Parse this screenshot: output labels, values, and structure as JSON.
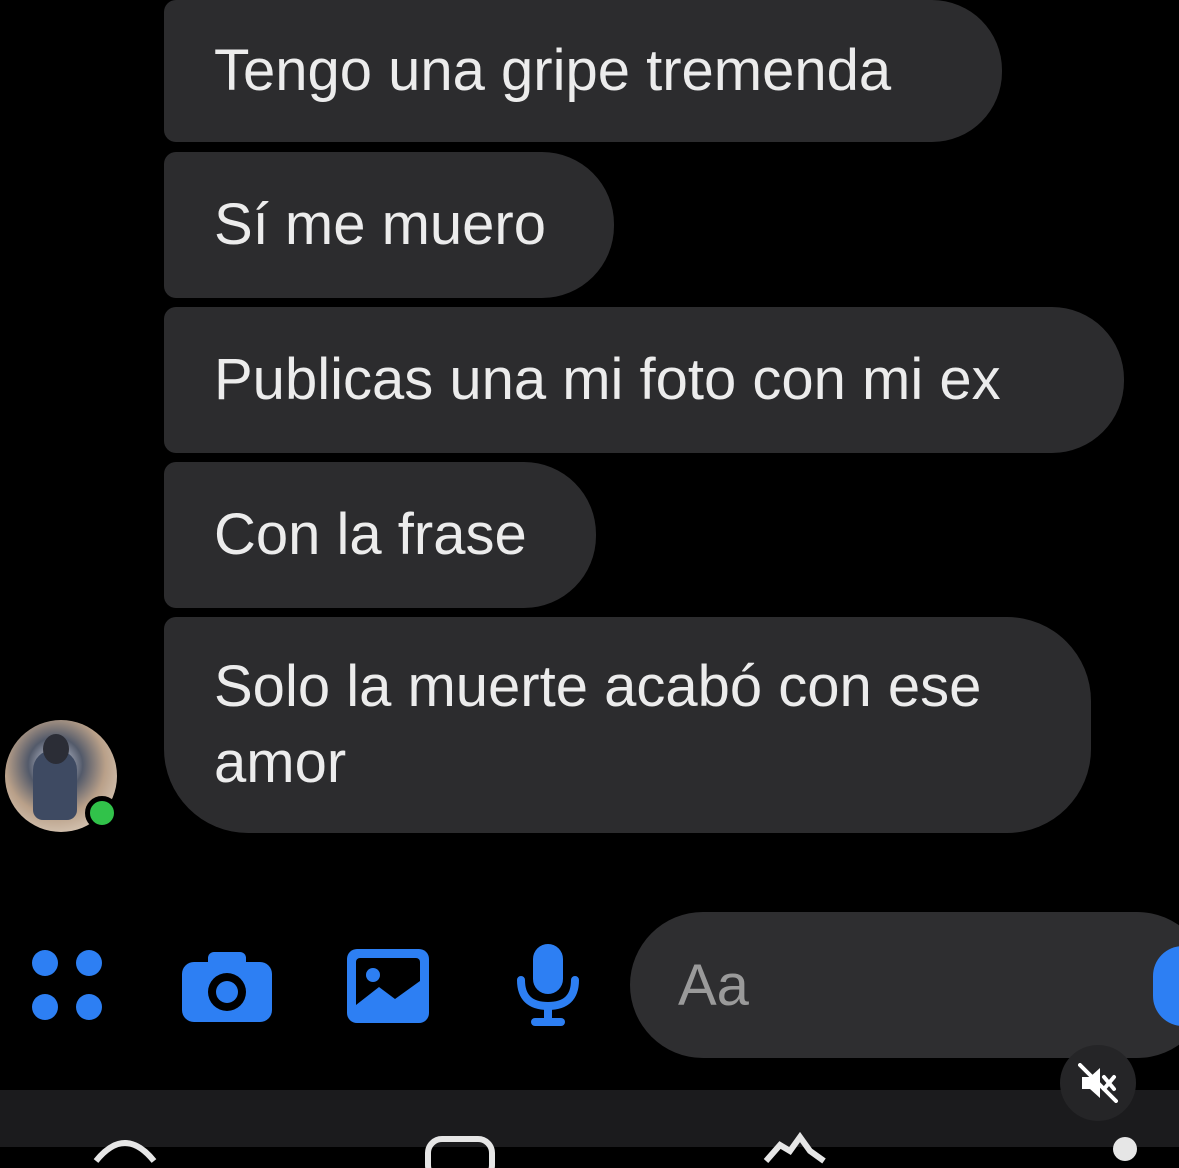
{
  "messages": [
    {
      "text": "Tengo una gripe tremenda"
    },
    {
      "text": "Sí me muero"
    },
    {
      "text": "Publicas una mi foto con mi ex"
    },
    {
      "text": "Con la frase"
    },
    {
      "text": "Solo la muerte acabó con ese amor"
    }
  ],
  "composer": {
    "placeholder": "Aa",
    "icons": [
      "apps-grid-icon",
      "camera-icon",
      "photo-gallery-icon",
      "microphone-icon"
    ]
  },
  "contact": {
    "status": "online"
  },
  "colors": {
    "background": "#000000",
    "bubble": "#2c2c2e",
    "accent": "#2d7ff3",
    "online": "#31c24a"
  }
}
